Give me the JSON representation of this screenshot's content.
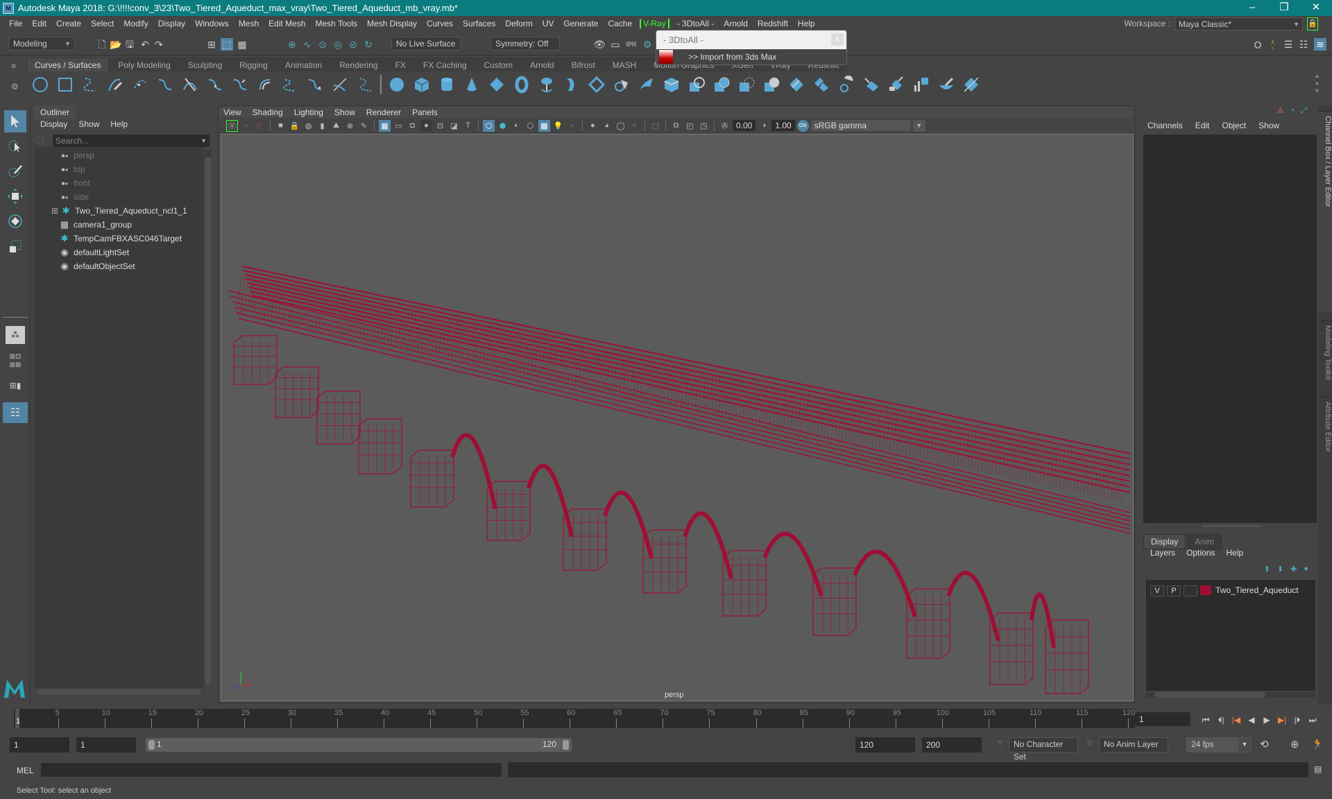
{
  "window": {
    "title": "Autodesk Maya 2018: G:\\!!!!conv_3\\23\\Two_Tiered_Aqueduct_max_vray\\Two_Tiered_Aqueduct_mb_vray.mb*",
    "logo": "M",
    "controls": {
      "minimize": "–",
      "maximize": "❐",
      "close": "✕"
    }
  },
  "menubar": {
    "items": [
      "File",
      "Edit",
      "Create",
      "Select",
      "Modify",
      "Display",
      "Windows",
      "Mesh",
      "Edit Mesh",
      "Mesh Tools",
      "Mesh Display",
      "Curves",
      "Surfaces",
      "Deform",
      "UV",
      "Generate",
      "Cache"
    ],
    "vray": "V-Ray",
    "items_after": [
      "- 3DtoAll -",
      "Arnold",
      "Redshift",
      "Help"
    ]
  },
  "workspace": {
    "label": "Workspace :",
    "value": "Maya Classic*",
    "lock_icon": "lock-icon"
  },
  "statusline": {
    "mode": "Modeling",
    "live_surface": "No Live Surface",
    "symmetry": "Symmetry: Off",
    "render_labels": [
      "IPR"
    ]
  },
  "popup": {
    "title": "- 3DtoAll -",
    "close": "x",
    "item": ">> Import from 3ds Max"
  },
  "shelf": {
    "tabs": [
      "Curves / Surfaces",
      "Poly Modeling",
      "Sculpting",
      "Rigging",
      "Animation",
      "Rendering",
      "FX",
      "FX Caching",
      "Custom",
      "Arnold",
      "Bifrost",
      "MASH",
      "Motion Graphics",
      "XGen",
      "VRay",
      "Redshift"
    ],
    "active_tab": "Curves / Surfaces"
  },
  "outliner": {
    "tab": "Outliner",
    "menu": [
      "Display",
      "Show",
      "Help"
    ],
    "search_placeholder": "Search...",
    "items": [
      {
        "label": "persp",
        "icon": "camera-icon",
        "dim": true
      },
      {
        "label": "top",
        "icon": "camera-icon",
        "dim": true
      },
      {
        "label": "front",
        "icon": "camera-icon",
        "dim": true
      },
      {
        "label": "side",
        "icon": "camera-icon",
        "dim": true
      },
      {
        "label": "Two_Tiered_Aqueduct_ncl1_1",
        "icon": "transform-icon",
        "expandable": true
      },
      {
        "label": "camera1_group",
        "icon": "group-icon"
      },
      {
        "label": "TempCamFBXASC046Target",
        "icon": "transform-icon"
      },
      {
        "label": "defaultLightSet",
        "icon": "set-icon"
      },
      {
        "label": "defaultObjectSet",
        "icon": "set-icon"
      }
    ]
  },
  "viewport": {
    "menu": [
      "View",
      "Shading",
      "Lighting",
      "Show",
      "Renderer",
      "Panels"
    ],
    "exposure": "0.00",
    "gamma": "1.00",
    "color_mgmt": "ON",
    "color_space": "sRGB gamma",
    "camera_label": "persp",
    "axis": {
      "x": "x",
      "y": "y",
      "z": "z"
    },
    "wire_color": "#9e0f35"
  },
  "channel_box": {
    "menu": [
      "Channels",
      "Edit",
      "Object",
      "Show"
    ]
  },
  "side_tabs": [
    "Channel Box / Layer Editor",
    "Modeling Toolkit",
    "Attribute Editor"
  ],
  "layer_editor": {
    "tabs": [
      "Display",
      "Anim"
    ],
    "active_tab": "Display",
    "menu": [
      "Layers",
      "Options",
      "Help"
    ],
    "layers": [
      {
        "v": "V",
        "p": "P",
        "color": "#9e0f35",
        "name": "Two_Tiered_Aqueduct"
      }
    ]
  },
  "timeline": {
    "ticks": [
      5,
      10,
      15,
      20,
      25,
      30,
      35,
      40,
      45,
      50,
      55,
      60,
      65,
      70,
      75,
      80,
      85,
      90,
      95,
      100,
      105,
      110,
      115,
      120
    ],
    "current_frame": "1",
    "current_field": "1",
    "min": 1,
    "max": 120
  },
  "range": {
    "start": "1",
    "playback_start": "1",
    "slider_start": "1",
    "slider_end": "120",
    "playback_end": "120",
    "end": "200",
    "character_set": "No Character Set",
    "anim_layer": "No Anim Layer",
    "fps": "24 fps"
  },
  "command_line": {
    "label": "MEL"
  },
  "help_line": {
    "text": "Select Tool: select an object"
  }
}
